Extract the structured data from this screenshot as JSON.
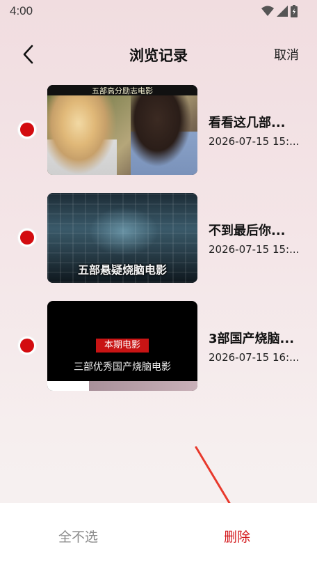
{
  "status_bar": {
    "time": "4:00",
    "icons": [
      "wifi-icon",
      "signal-icon",
      "battery-icon"
    ]
  },
  "header": {
    "title": "浏览记录",
    "cancel_label": "取消",
    "back_icon": "back-arrow-icon"
  },
  "history": {
    "items": [
      {
        "title": "看看这几部...",
        "date": "2026-07-15 15:...",
        "thumbnail_caption": "五部高分励志电影",
        "selected": true
      },
      {
        "title": "不到最后你...",
        "date": "2026-07-15 15:...",
        "thumbnail_caption": "五部悬疑烧脑电影",
        "selected": true
      },
      {
        "title": "3部国产烧脑...",
        "date": "2026-07-15 16:...",
        "thumbnail_label": "本期电影",
        "thumbnail_caption": "三部优秀国产烧脑电影",
        "selected": true
      }
    ]
  },
  "bottom_bar": {
    "select_none_label": "全不选",
    "delete_label": "删除"
  },
  "colors": {
    "accent_red": "#d30c10",
    "delete_red": "#d3161a",
    "muted_gray": "#8a8a8a"
  }
}
